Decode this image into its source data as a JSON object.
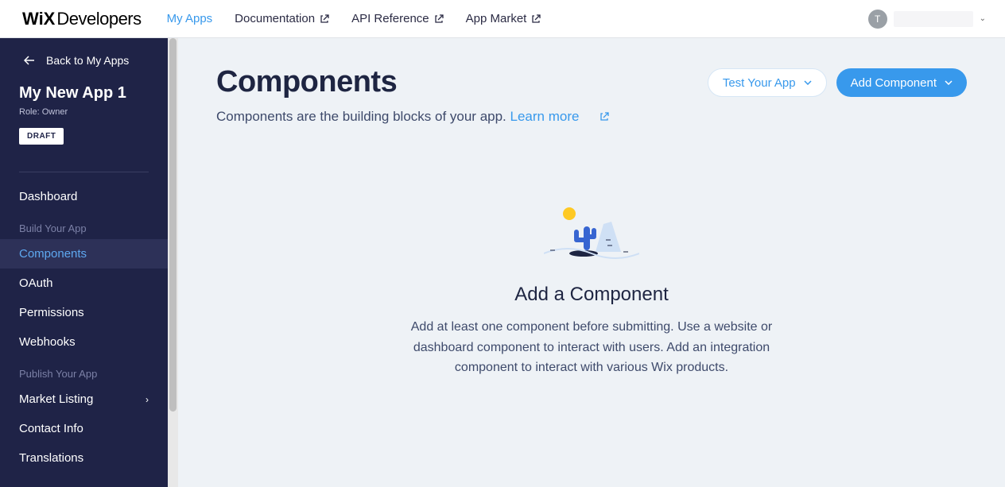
{
  "logo": {
    "wix": "WiX",
    "dev": "Developers"
  },
  "topnav": {
    "my_apps": "My Apps",
    "documentation": "Documentation",
    "api_reference": "API Reference",
    "app_market": "App Market"
  },
  "user": {
    "initial": "T"
  },
  "sidebar": {
    "back": "Back to My Apps",
    "app_title": "My New App 1",
    "role": "Role: Owner",
    "draft": "DRAFT",
    "dashboard": "Dashboard",
    "section_build": "Build Your App",
    "components": "Components",
    "oauth": "OAuth",
    "permissions": "Permissions",
    "webhooks": "Webhooks",
    "section_publish": "Publish Your App",
    "market_listing": "Market Listing",
    "contact_info": "Contact Info",
    "translations": "Translations"
  },
  "main": {
    "title": "Components",
    "subtitle": "Components are the building blocks of your app. ",
    "learn_more": "Learn more",
    "test_btn": "Test Your App",
    "add_btn": "Add Component",
    "empty_title": "Add a Component",
    "empty_desc": "Add at least one component before submitting. Use a website or dashboard component to interact with users. Add an integration component to interact with various Wix products."
  }
}
